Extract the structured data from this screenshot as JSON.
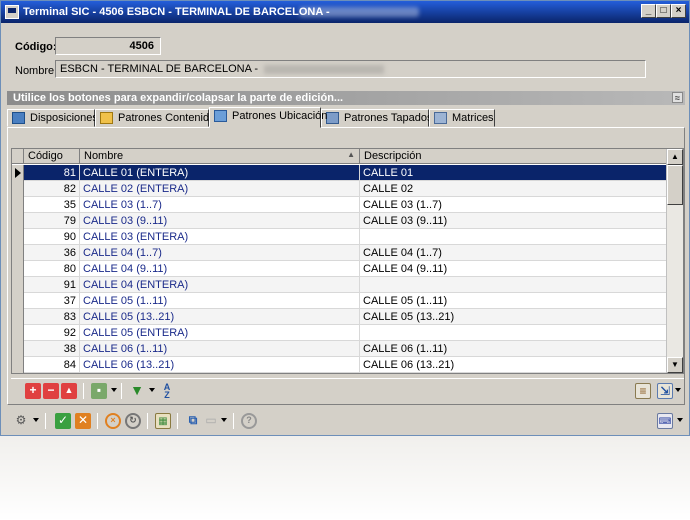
{
  "window": {
    "title": "Terminal SIC - 4506  ESBCN - TERMINAL DE BARCELONA -",
    "minimize": "_",
    "maximize": "□",
    "close": "×"
  },
  "header": {
    "codigo_label": "Código:",
    "codigo_value": "4506",
    "nombre_label": "Nombre:",
    "nombre_value": "ESBCN - TERMINAL DE BARCELONA -"
  },
  "expand_bar": {
    "text": "Utilice los botones para expandir/colapsar la parte de edición...",
    "chevron": "≈"
  },
  "tabs": [
    {
      "label": "Disposiciones",
      "active": false
    },
    {
      "label": "Patrones Contenido",
      "active": false
    },
    {
      "label": "Patrones Ubicación",
      "active": true
    },
    {
      "label": "Patrones Tapados",
      "active": false
    },
    {
      "label": "Matrices",
      "active": false
    }
  ],
  "grid": {
    "columns": [
      "Código",
      "Nombre",
      "Descripción"
    ],
    "sort_indicator": "▲",
    "rows": [
      {
        "codigo": "81",
        "nombre": "CALLE 01 (ENTERA)",
        "descripcion": "CALLE 01",
        "selected": true
      },
      {
        "codigo": "82",
        "nombre": "CALLE 02 (ENTERA)",
        "descripcion": "CALLE 02"
      },
      {
        "codigo": "35",
        "nombre": "CALLE 03 (1..7)",
        "descripcion": "CALLE 03 (1..7)"
      },
      {
        "codigo": "79",
        "nombre": "CALLE 03 (9..11)",
        "descripcion": "CALLE 03 (9..11)"
      },
      {
        "codigo": "90",
        "nombre": "CALLE 03 (ENTERA)",
        "descripcion": ""
      },
      {
        "codigo": "36",
        "nombre": "CALLE 04 (1..7)",
        "descripcion": "CALLE 04 (1..7)"
      },
      {
        "codigo": "80",
        "nombre": "CALLE 04 (9..11)",
        "descripcion": "CALLE 04 (9..11)"
      },
      {
        "codigo": "91",
        "nombre": "CALLE 04 (ENTERA)",
        "descripcion": ""
      },
      {
        "codigo": "37",
        "nombre": "CALLE 05 (1..11)",
        "descripcion": "CALLE 05 (1..11)"
      },
      {
        "codigo": "83",
        "nombre": "CALLE 05 (13..21)",
        "descripcion": "CALLE 05 (13..21)"
      },
      {
        "codigo": "92",
        "nombre": "CALLE 05 (ENTERA)",
        "descripcion": ""
      },
      {
        "codigo": "38",
        "nombre": "CALLE 06 (1..11)",
        "descripcion": "CALLE 06 (1..11)"
      },
      {
        "codigo": "84",
        "nombre": "CALLE 06 (13..21)",
        "descripcion": "CALLE 06 (13..21)"
      }
    ]
  },
  "colors": {
    "title_bar": "#0a246a",
    "selected_row": "#0a246a",
    "name_text": "#1a2a8a",
    "add_button": "#e04040",
    "confirm_green": "#3aa040",
    "cancel_orange": "#e08020"
  },
  "icons": {
    "grid_toolbar": [
      "add-icon",
      "remove-icon",
      "collapse-icon",
      "view-icon",
      "filter-icon",
      "sort-az-icon",
      "columns-icon",
      "export-icon"
    ],
    "bottom_toolbar": [
      "tools-icon",
      "accept-icon",
      "reject-icon",
      "cancel-icon",
      "refresh-icon",
      "calculator-icon",
      "copy-icon",
      "paste-icon",
      "help-icon",
      "keyboard-icon"
    ]
  }
}
